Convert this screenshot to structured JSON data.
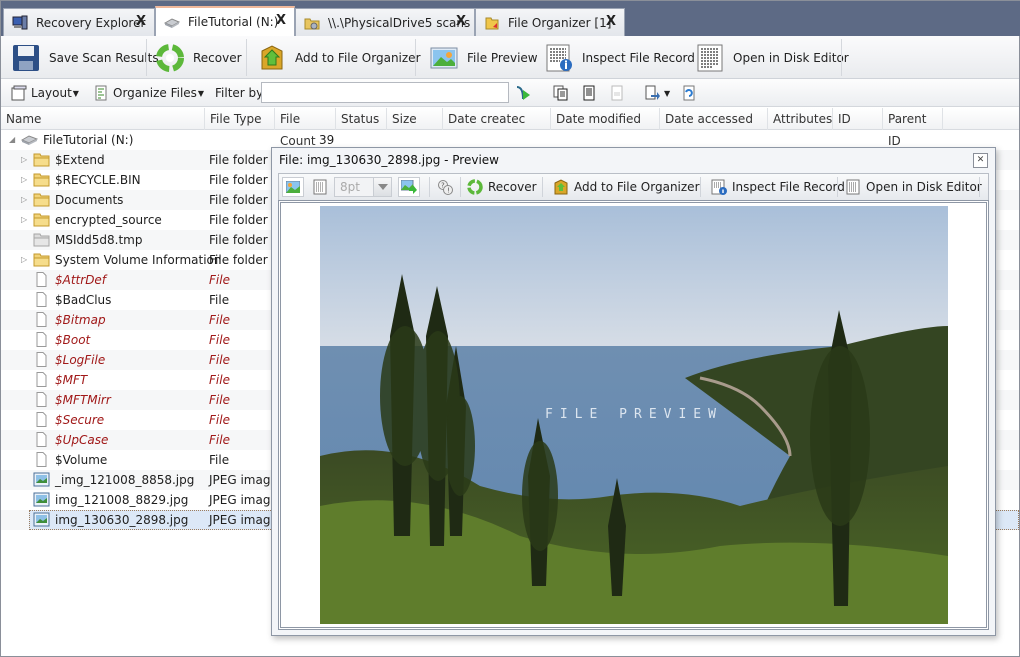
{
  "tabs": [
    {
      "label": "Recovery Explorer",
      "icon": "computer-icon",
      "close": "X"
    },
    {
      "label": "FileTutorial (N:)",
      "icon": "drive-icon",
      "close": "X",
      "active": true
    },
    {
      "label": "\\\\.\\PhysicalDrive5 scans",
      "icon": "scan-folder-icon",
      "close": "X"
    },
    {
      "label": "File Organizer [1]",
      "icon": "organizer-icon",
      "close": "X"
    }
  ],
  "ribbon": {
    "save_scan": "Save Scan Results",
    "recover": "Recover",
    "add_organizer": "Add to File Organizer",
    "file_preview": "File Preview",
    "inspect_record": "Inspect File Record",
    "open_disk_editor": "Open in Disk Editor"
  },
  "toolbar": {
    "layout": "Layout",
    "organize": "Organize Files",
    "filter_label": "Filter by:",
    "filter_value": ""
  },
  "columns": [
    "Name",
    "File Type",
    "File Count",
    "Status",
    "Size",
    "Date createc",
    "Date modified",
    "Date accessed",
    "Attributes",
    "ID",
    "Parent ID"
  ],
  "tree": {
    "root": {
      "name": "FileTutorial (N:)",
      "count": "39"
    },
    "items": [
      {
        "name": "$Extend",
        "type": "File folder",
        "kind": "folder",
        "expandable": true,
        "system": false
      },
      {
        "name": "$RECYCLE.BIN",
        "type": "File folder",
        "kind": "folder",
        "expandable": true,
        "system": false
      },
      {
        "name": "Documents",
        "type": "File folder",
        "kind": "folder",
        "expandable": true,
        "system": false
      },
      {
        "name": "encrypted_source",
        "type": "File folder",
        "kind": "folder",
        "expandable": true,
        "system": false
      },
      {
        "name": "MSIdd5d8.tmp",
        "type": "File folder",
        "kind": "folder-gray",
        "expandable": false,
        "system": false
      },
      {
        "name": "System Volume Information",
        "type": "File folder",
        "kind": "folder",
        "expandable": true,
        "system": false
      },
      {
        "name": "$AttrDef",
        "type": "File",
        "kind": "file",
        "expandable": false,
        "system": true
      },
      {
        "name": "$BadClus",
        "type": "File",
        "kind": "file",
        "expandable": false,
        "system": false
      },
      {
        "name": "$Bitmap",
        "type": "File",
        "kind": "file",
        "expandable": false,
        "system": true
      },
      {
        "name": "$Boot",
        "type": "File",
        "kind": "file",
        "expandable": false,
        "system": true
      },
      {
        "name": "$LogFile",
        "type": "File",
        "kind": "file",
        "expandable": false,
        "system": true
      },
      {
        "name": "$MFT",
        "type": "File",
        "kind": "file",
        "expandable": false,
        "system": true
      },
      {
        "name": "$MFTMirr",
        "type": "File",
        "kind": "file",
        "expandable": false,
        "system": true
      },
      {
        "name": "$Secure",
        "type": "File",
        "kind": "file",
        "expandable": false,
        "system": true
      },
      {
        "name": "$UpCase",
        "type": "File",
        "kind": "file",
        "expandable": false,
        "system": true
      },
      {
        "name": "$Volume",
        "type": "File",
        "kind": "file",
        "expandable": false,
        "system": false
      },
      {
        "name": "_img_121008_8858.jpg",
        "type": "JPEG image",
        "kind": "image",
        "expandable": false,
        "system": false
      },
      {
        "name": "img_121008_8829.jpg",
        "type": "JPEG image",
        "kind": "image",
        "expandable": false,
        "system": false
      },
      {
        "name": "img_130630_2898.jpg",
        "type": "JPEG image",
        "kind": "image",
        "expandable": false,
        "system": false,
        "selected": true
      }
    ]
  },
  "preview": {
    "title": "File: img_130630_2898.jpg - Preview",
    "zoom_value": "8pt",
    "recover": "Recover",
    "add_organizer": "Add to File Organizer",
    "inspect_record": "Inspect File Record",
    "open_disk_editor": "Open in Disk Editor",
    "watermark": "FILE PREVIEW"
  },
  "colors": {
    "system_file": "#a01818",
    "tabbar": "#5d6a85",
    "selection": "#dce8f7"
  }
}
